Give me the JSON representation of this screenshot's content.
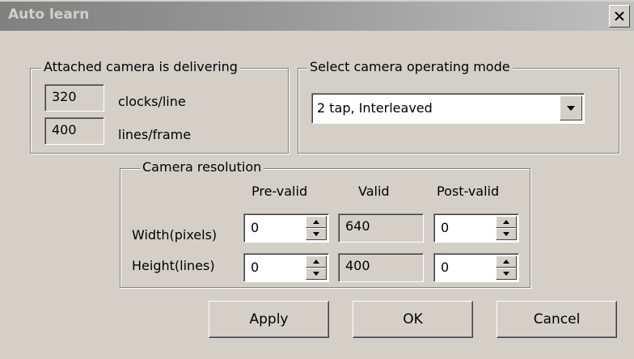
{
  "window": {
    "title": "Auto learn",
    "close_glyph": "×"
  },
  "camera_group": {
    "title": "Attached camera is delivering",
    "clocks_value": "320",
    "clocks_label": "clocks/line",
    "lines_value": "400",
    "lines_label": "lines/frame"
  },
  "mode_group": {
    "title": "Select camera operating mode",
    "selected": "2 tap, Interleaved"
  },
  "resolution_group": {
    "title": "Camera resolution",
    "headers": {
      "pre": "Pre-valid",
      "valid": "Valid",
      "post": "Post-valid"
    },
    "rows": [
      {
        "label": "Width(pixels)",
        "pre": "0",
        "valid": "640",
        "post": "0"
      },
      {
        "label": "Height(lines)",
        "pre": "0",
        "valid": "400",
        "post": "0"
      }
    ]
  },
  "buttons": {
    "apply": "Apply",
    "ok": "OK",
    "cancel": "Cancel"
  },
  "colors": {
    "face": "#d4d0c8",
    "title_gradient_start": "#808080",
    "title_gradient_end": "#c0c0c0"
  },
  "icons": {
    "close": "close-icon",
    "dropdown": "chevron-down-icon",
    "spin_up": "spin-up-icon",
    "spin_down": "spin-down-icon"
  }
}
